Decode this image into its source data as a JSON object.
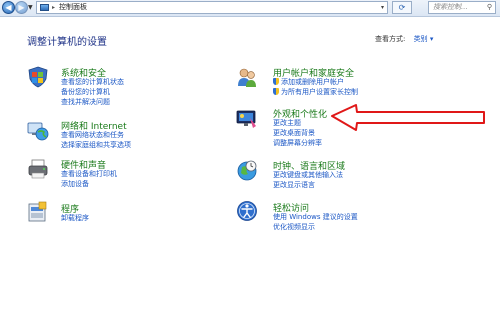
{
  "address": {
    "crumb": "控制面板",
    "search_placeholder": "搜索控制..."
  },
  "heading": "调整计算机的设置",
  "view_by": {
    "label": "查看方式:",
    "value": "类别"
  },
  "categories_left": [
    {
      "title": "系统和安全",
      "links": [
        "查看您的计算机状态",
        "备份您的计算机",
        "查找并解决问题"
      ]
    },
    {
      "title": "网络和 Internet",
      "links": [
        "查看网络状态和任务",
        "选择家庭组和共享选项"
      ]
    },
    {
      "title": "硬件和声音",
      "links": [
        "查看设备和打印机",
        "添加设备"
      ]
    },
    {
      "title": "程序",
      "links": [
        "卸载程序"
      ]
    }
  ],
  "categories_right": [
    {
      "title": "用户帐户和家庭安全",
      "links": [
        "添加或删除用户帐户",
        "为所有用户设置家长控制"
      ]
    },
    {
      "title": "外观和个性化",
      "links": [
        "更改主题",
        "更改桌面背景",
        "调整屏幕分辨率"
      ]
    },
    {
      "title": "时钟、语言和区域",
      "links": [
        "更改键盘或其他输入法",
        "更改显示语言"
      ]
    },
    {
      "title": "轻松访问",
      "links": [
        "使用 Windows 建议的设置",
        "优化视频显示"
      ]
    }
  ],
  "colors": {
    "heading": "#1e3287",
    "category": "#1a7a1a",
    "link": "#1b57c5",
    "arrow": "#e01818"
  }
}
